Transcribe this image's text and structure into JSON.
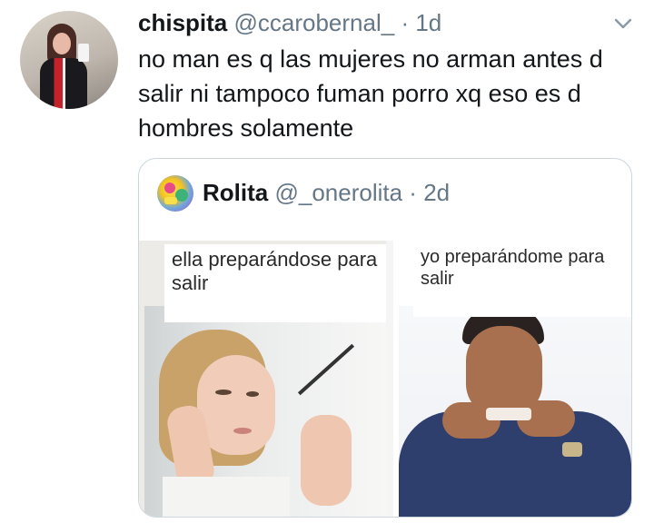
{
  "tweet": {
    "display_name": "chispita",
    "handle": "@ccarobernal_",
    "separator": "·",
    "time": "1d",
    "text": "no man es q las mujeres no arman antes d salir ni tampoco fuman porro xq eso es d hombres solamente"
  },
  "quoted_tweet": {
    "display_name": "Rolita",
    "handle": "@_onerolita",
    "separator": "·",
    "time": "2d",
    "meme": {
      "left_caption": "ella preparándose para salir",
      "right_caption": "yo preparándome para salir"
    }
  },
  "icons": {
    "menu": "chevron-down-icon"
  },
  "colors": {
    "text_primary": "#14171a",
    "text_secondary": "#657786",
    "border": "#ccd6dd"
  }
}
